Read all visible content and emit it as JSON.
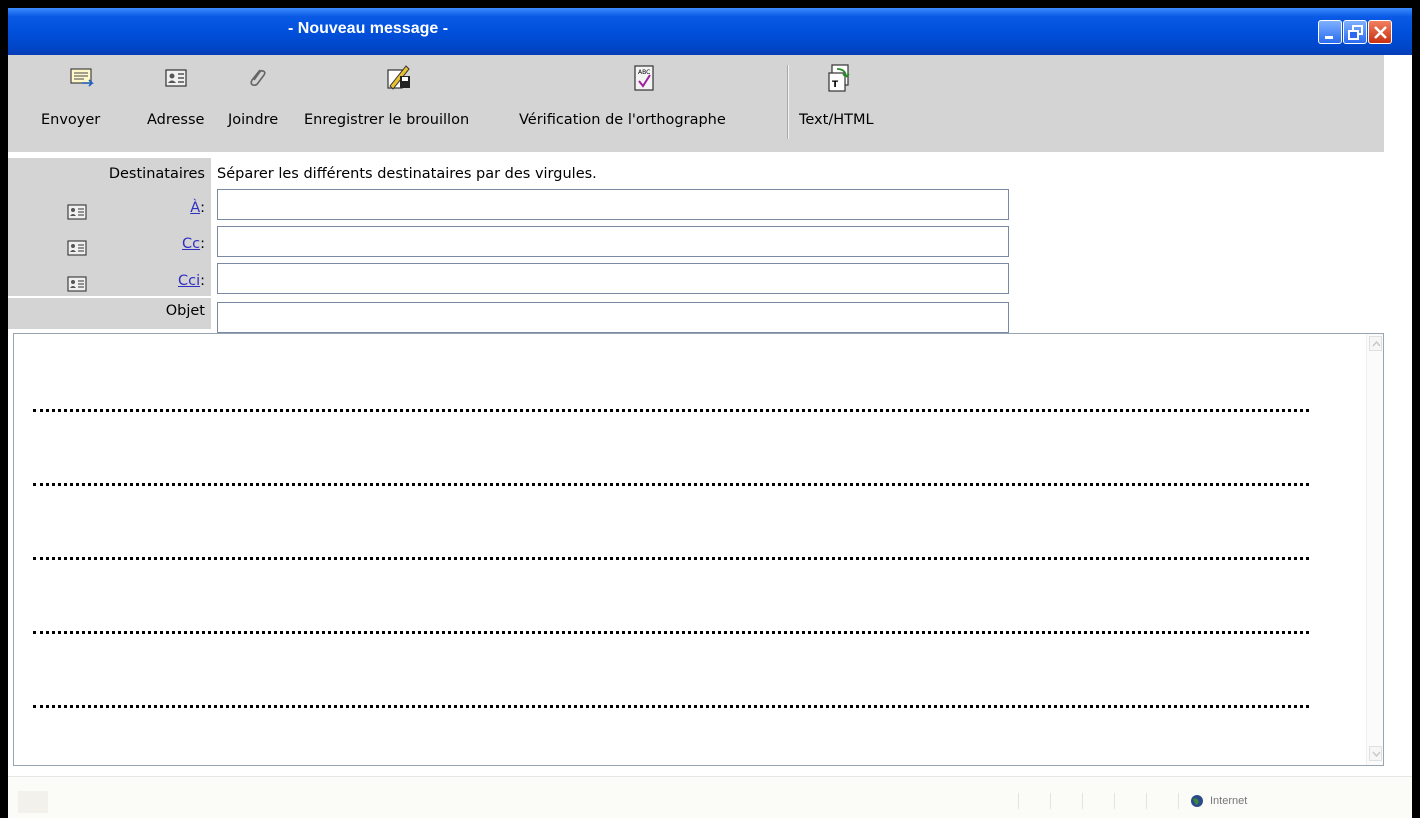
{
  "window": {
    "title": "- Nouveau message -"
  },
  "toolbar": {
    "buttons": [
      {
        "label": "Envoyer",
        "icon": "send-icon"
      },
      {
        "label": "Adresse",
        "icon": "address-book-icon"
      },
      {
        "label": "Joindre",
        "icon": "paperclip-icon"
      },
      {
        "label": "Enregistrer le brouillon",
        "icon": "save-draft-icon"
      },
      {
        "label": "Vérification de l'orthographe",
        "icon": "spellcheck-icon"
      },
      {
        "label": "Text/HTML",
        "icon": "text-html-icon"
      }
    ]
  },
  "header": {
    "recipients_label": "Destinataires",
    "recipients_hint": "Séparer les différents destinataires par des virgules.",
    "to_label": "À",
    "cc_label": "Cc",
    "bcc_label": "Cci",
    "colon": ":",
    "subject_label": "Objet",
    "to_value": "",
    "cc_value": "",
    "bcc_value": "",
    "subject_value": ""
  },
  "status": {
    "zone": "Internet"
  },
  "colors": {
    "titlebar": "#0050dc",
    "toolbar_bg": "#d4d4d4",
    "link": "#3030c0"
  }
}
